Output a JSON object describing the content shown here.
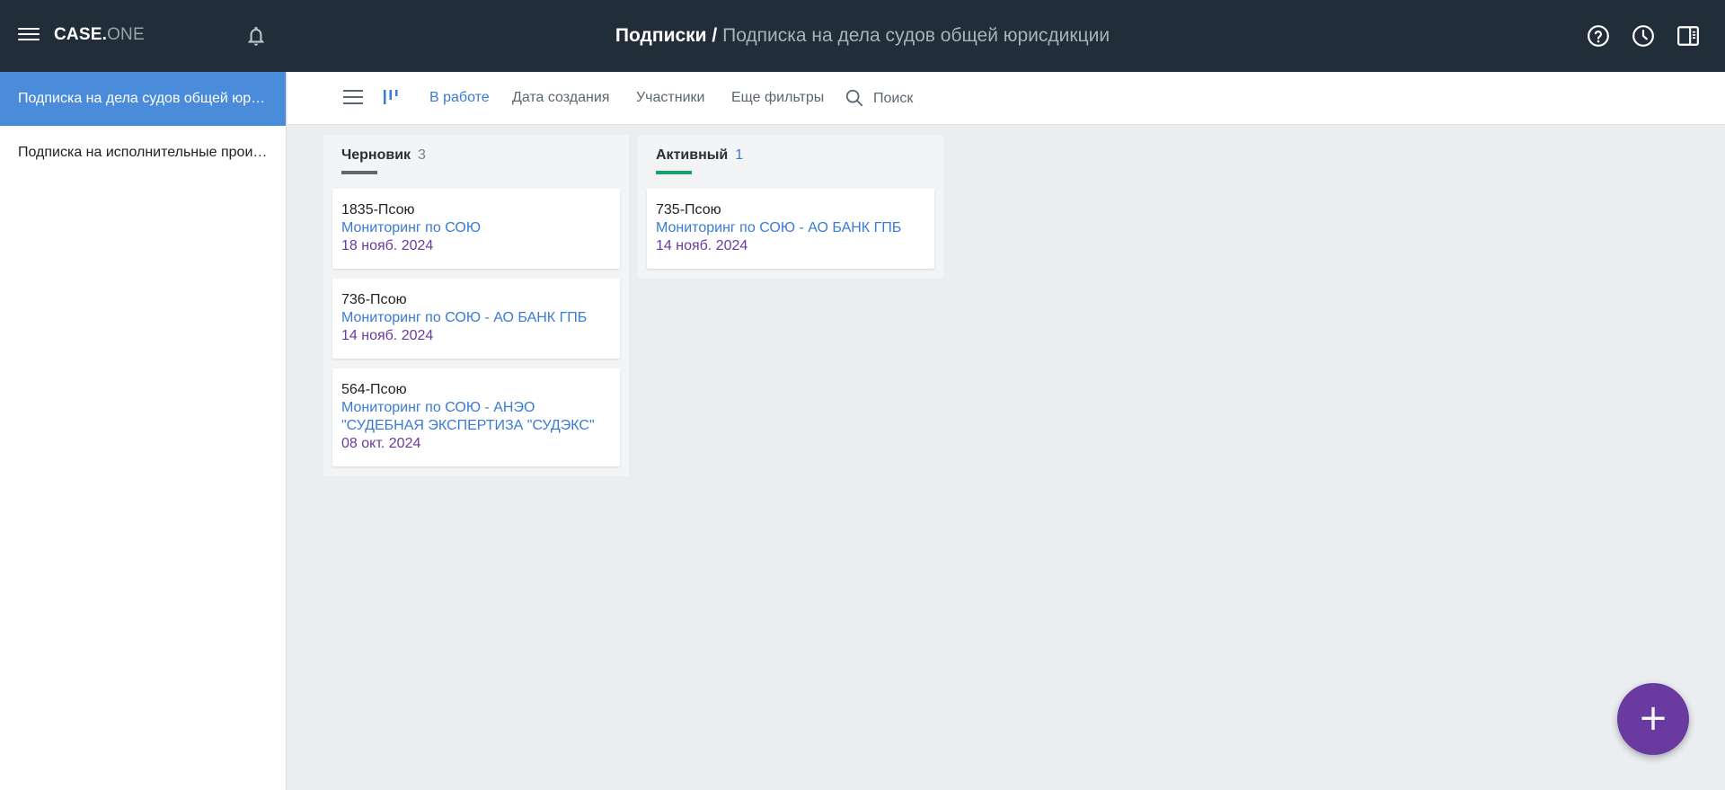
{
  "header": {
    "logo_main": "CASE.",
    "logo_sub": "ONE",
    "breadcrumb_root": "Подписки",
    "breadcrumb_sep": " / ",
    "breadcrumb_current": "Подписка на дела судов общей юрисдикции",
    "icons": [
      "menu-icon",
      "bell-icon",
      "help-icon",
      "history-icon",
      "panel-icon"
    ]
  },
  "sidebar": {
    "items": [
      {
        "label": "Подписка на дела судов общей юрисдикции",
        "active": true
      },
      {
        "label": "Подписка на исполнительные производства",
        "active": false
      }
    ]
  },
  "toolbar": {
    "view_icons": [
      "list-view-icon",
      "kanban-view-icon"
    ],
    "filters": [
      {
        "label": "В работе",
        "active": true
      },
      {
        "label": "Дата создания",
        "active": false
      },
      {
        "label": "Участники",
        "active": false
      },
      {
        "label": "Еще фильтры",
        "active": false
      }
    ],
    "search_placeholder": "Поиск"
  },
  "columns": [
    {
      "name": "Черновик",
      "count": "3",
      "bar_color": "#666666",
      "count_color": "#7a8087",
      "cards": [
        {
          "number": "1835-Псою",
          "title": "Мониторинг по СОЮ",
          "date": "18 нояб. 2024"
        },
        {
          "number": "736-Псою",
          "title": "Мониторинг по СОЮ - АО БАНК ГПБ",
          "date": "14 нояб. 2024"
        },
        {
          "number": "564-Псою",
          "title": "Мониторинг по СОЮ - АНЭО \"СУДЕБНАЯ ЭКСПЕРТИЗА \"СУДЭКС\"",
          "date": "08 окт. 2024"
        }
      ]
    },
    {
      "name": "Активный",
      "count": "1",
      "bar_color": "#1e9e6a",
      "count_color": "#3a7bd5",
      "cards": [
        {
          "number": "735-Псою",
          "title": "Мониторинг по СОЮ - АО БАНК ГПБ",
          "date": "14 нояб. 2024"
        }
      ]
    }
  ],
  "fab": {
    "label": "+"
  },
  "colors": {
    "topbar": "#222d3a",
    "accent": "#4a8cd9",
    "link": "#3a7bd5",
    "date": "#6a3aa0",
    "fab": "#6a3aa0"
  }
}
